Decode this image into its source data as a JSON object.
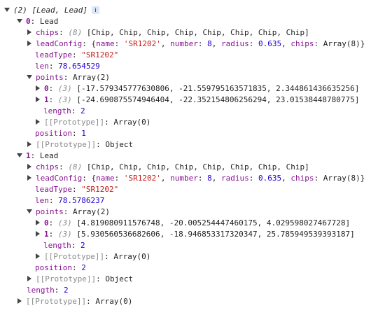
{
  "root": {
    "count": "(2)",
    "summary": "[Lead, Lead]",
    "info_glyph": "i",
    "length_key": "length",
    "length_val": "2",
    "proto_key": "[[Prototype]]",
    "proto_val": "Array(0)"
  },
  "lead0": {
    "key": "0",
    "type": "Lead",
    "chips_key": "chips",
    "chips_count": "(8)",
    "chips_val": "[Chip, Chip, Chip, Chip, Chip, Chip, Chip, Chip]",
    "leadConfig_key": "leadConfig",
    "lc_open": "{",
    "lc_name_key": "name",
    "lc_name_val": "'SR1202'",
    "lc_number_key": "number",
    "lc_number_val": "8",
    "lc_radius_key": "radius",
    "lc_radius_val": "0.635",
    "lc_chips_key": "chips",
    "lc_chips_val": "Array(8)",
    "lc_close": "}",
    "leadType_key": "leadType",
    "leadType_val": "\"SR1202\"",
    "len_key": "len",
    "len_val": "78.654529",
    "points_key": "points",
    "points_val": "Array(2)",
    "p0_key": "0",
    "p0_count": "(3)",
    "p0_val": "[-17.579345777630806, -21.559795163571835, 2.344861436635256]",
    "p1_key": "1",
    "p1_count": "(3)",
    "p1_val": "[-24.690875574946404, -22.352154806256294, 23.01538448780775]",
    "plen_key": "length",
    "plen_val": "2",
    "pproto_key": "[[Prototype]]",
    "pproto_val": "Array(0)",
    "position_key": "position",
    "position_val": "1",
    "proto_key": "[[Prototype]]",
    "proto_val": "Object"
  },
  "lead1": {
    "key": "1",
    "type": "Lead",
    "chips_key": "chips",
    "chips_count": "(8)",
    "chips_val": "[Chip, Chip, Chip, Chip, Chip, Chip, Chip, Chip]",
    "leadConfig_key": "leadConfig",
    "lc_open": "{",
    "lc_name_key": "name",
    "lc_name_val": "'SR1202'",
    "lc_number_key": "number",
    "lc_number_val": "8",
    "lc_radius_key": "radius",
    "lc_radius_val": "0.635",
    "lc_chips_key": "chips",
    "lc_chips_val": "Array(8)",
    "lc_close": "}",
    "leadType_key": "leadType",
    "leadType_val": "\"SR1202\"",
    "len_key": "len",
    "len_val": "78.5786237",
    "points_key": "points",
    "points_val": "Array(2)",
    "p0_key": "0",
    "p0_count": "(3)",
    "p0_val": "[4.819080911576748, -20.005254447460175, 4.029598027467728]",
    "p1_key": "1",
    "p1_count": "(3)",
    "p1_val": "[5.930560536682606, -18.946853317320347, 25.785949539393187]",
    "plen_key": "length",
    "plen_val": "2",
    "pproto_key": "[[Prototype]]",
    "pproto_val": "Array(0)",
    "position_key": "position",
    "position_val": "2",
    "proto_key": "[[Prototype]]",
    "proto_val": "Object"
  },
  "colors": {
    "key": "#881391",
    "string": "#c41a16",
    "number": "#1c00cf",
    "dim": "#8a8a8a",
    "triangle": "#444444"
  },
  "icons": [
    "triangle-down-icon",
    "triangle-right-icon",
    "info-icon"
  ]
}
